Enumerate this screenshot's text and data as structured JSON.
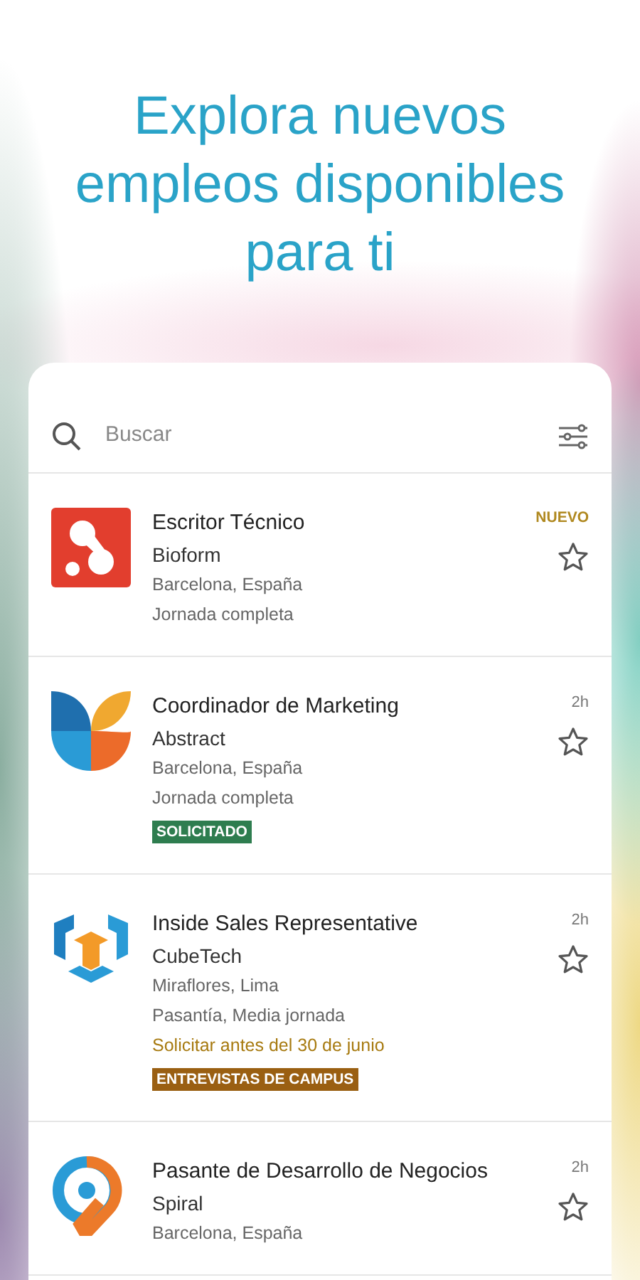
{
  "headline": "Explora nuevos empleos disponibles para ti",
  "search": {
    "placeholder": "Buscar"
  },
  "jobs": [
    {
      "kind": "blob",
      "title": "Escritor Técnico",
      "company": "Bioform",
      "location": "Barcelona, España",
      "type": "Jornada completa",
      "meta": {
        "kind": "new",
        "text": "NUEVO"
      },
      "starred": false
    },
    {
      "kind": "petals",
      "title": "Coordinador de Marketing",
      "company": "Abstract",
      "location": "Barcelona, España",
      "type": "Jornada completa",
      "meta": {
        "kind": "time",
        "text": "2h"
      },
      "tag": {
        "kind": "applied",
        "text": "SOLICITADO"
      },
      "starred": false
    },
    {
      "kind": "cube",
      "title": "Inside Sales Representative",
      "company": "CubeTech",
      "location": "Miraflores, Lima",
      "type": "Pasantía, Media jornada",
      "deadline": "Solicitar antes del 30 de junio",
      "meta": {
        "kind": "time",
        "text": "2h"
      },
      "tag": {
        "kind": "campus",
        "text": "ENTREVISTAS DE CAMPUS"
      },
      "starred": false
    },
    {
      "kind": "pin",
      "title": "Pasante de Desarrollo de Negocios",
      "company": "Spiral",
      "location": "Barcelona, España",
      "meta": {
        "kind": "time",
        "text": "2h"
      },
      "starred": false
    }
  ]
}
